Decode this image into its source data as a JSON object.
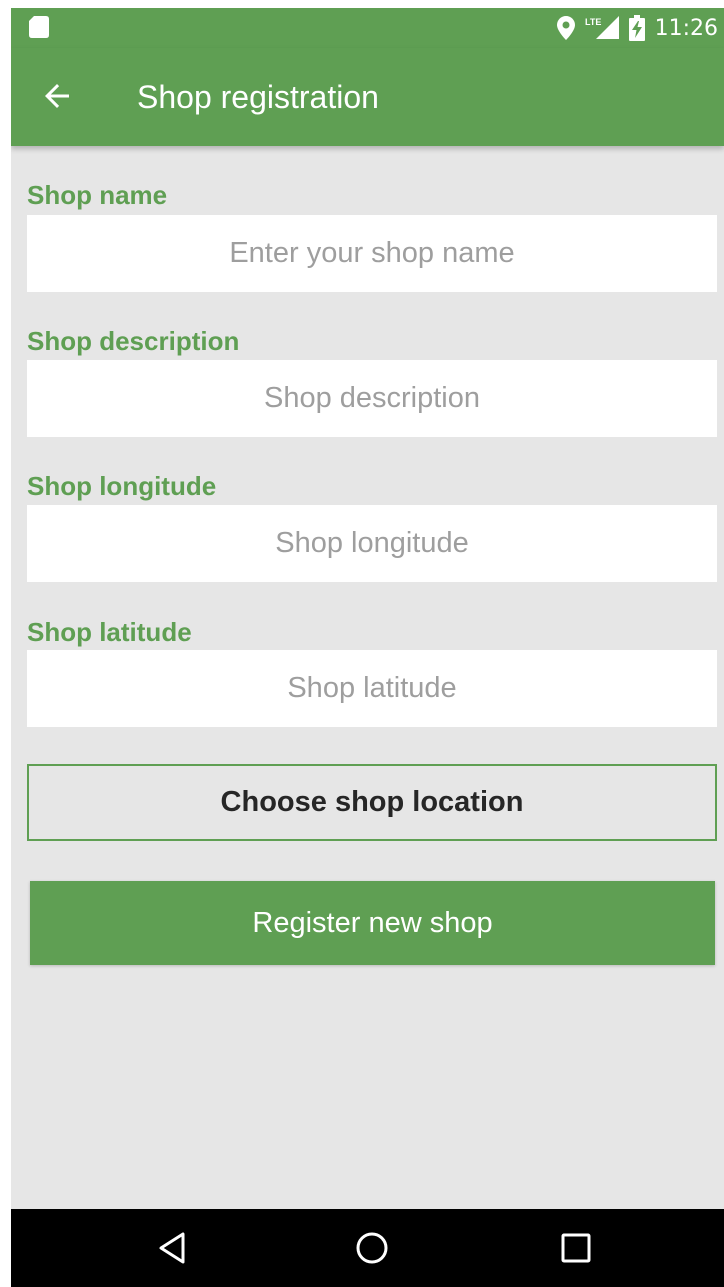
{
  "status_bar": {
    "network_label": "LTE",
    "time": "11:26",
    "icons": [
      "sd-card-icon",
      "location-pin-icon",
      "lte-signal-icon",
      "battery-charging-icon"
    ]
  },
  "app_bar": {
    "title": "Shop registration",
    "back_icon": "arrow-back-icon"
  },
  "form": {
    "fields": [
      {
        "label": "Shop name",
        "placeholder": "Enter your shop name",
        "value": ""
      },
      {
        "label": "Shop description",
        "placeholder": "Shop description",
        "value": ""
      },
      {
        "label": "Shop longitude",
        "placeholder": "Shop longitude",
        "value": ""
      },
      {
        "label": "Shop latitude",
        "placeholder": "Shop latitude",
        "value": ""
      }
    ],
    "choose_location_label": "Choose shop location",
    "register_label": "Register new shop"
  },
  "navigation": {
    "icons": [
      "nav-back-icon",
      "nav-home-icon",
      "nav-recents-icon"
    ]
  },
  "colors": {
    "primary": "#5f9f53",
    "background": "#e6e6e6",
    "nav_bar": "#000000"
  }
}
